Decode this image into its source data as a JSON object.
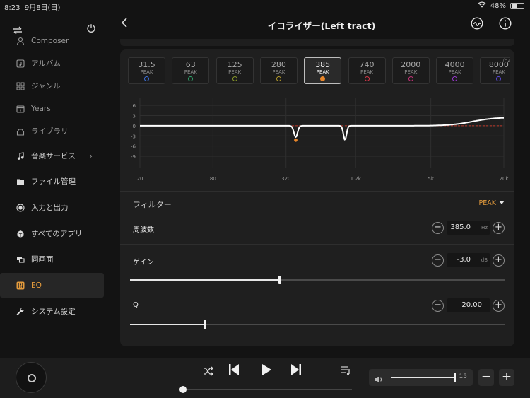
{
  "status": {
    "time": "8:23",
    "date": "9月8日(日)",
    "battery": "48%",
    "battery_level": 0.48
  },
  "sidebar": {
    "items": [
      {
        "label": "Composer",
        "icon": "person-icon",
        "dim": true
      },
      {
        "label": "アルバム",
        "icon": "album-icon",
        "dim": true
      },
      {
        "label": "ジャンル",
        "icon": "genre-grid-icon",
        "dim": true
      },
      {
        "label": "Years",
        "icon": "calendar-icon",
        "dim": true
      },
      {
        "label": "ライブラリ",
        "icon": "library-icon",
        "dim": true
      },
      {
        "label": "音楽サービス",
        "icon": "music-note-icon",
        "chevron": true
      },
      {
        "label": "ファイル管理",
        "icon": "folder-icon"
      },
      {
        "label": "入力と出力",
        "icon": "io-icon"
      },
      {
        "label": "すべてのアプリ",
        "icon": "apps-cube-icon"
      },
      {
        "label": "同画面",
        "icon": "screen-mirror-icon"
      },
      {
        "label": "EQ",
        "icon": "eq-icon",
        "active": true
      },
      {
        "label": "システム設定",
        "icon": "wrench-icon"
      }
    ]
  },
  "header": {
    "title": "イコライザー(Left tract)"
  },
  "bands": {
    "unit": "/Hz",
    "items": [
      {
        "freq": "31.5",
        "type": "PEAK",
        "color": "#3b6fd8"
      },
      {
        "freq": "63",
        "type": "PEAK",
        "color": "#2fa36b"
      },
      {
        "freq": "125",
        "type": "PEAK",
        "color": "#8a9a2a"
      },
      {
        "freq": "280",
        "type": "PEAK",
        "color": "#b49a2a"
      },
      {
        "freq": "385",
        "type": "PEAK",
        "color": "#e8862a",
        "selected": true
      },
      {
        "freq": "740",
        "type": "PEAK",
        "color": "#d8384a"
      },
      {
        "freq": "2000",
        "type": "PEAK",
        "color": "#c8327a"
      },
      {
        "freq": "4000",
        "type": "PEAK",
        "color": "#9a3ad0"
      },
      {
        "freq": "8000",
        "type": "PEAK",
        "color": "#5a48d8"
      }
    ]
  },
  "graph": {
    "y_ticks": [
      "6",
      "3",
      "0",
      "-3",
      "-6",
      "-9"
    ],
    "x_ticks": [
      "20",
      "80",
      "320",
      "1.2k",
      "5k",
      "20k"
    ],
    "curve_color": "#ffffff",
    "zero_line_color": "#c0392b",
    "marker_color": "#e8862a"
  },
  "filter": {
    "label": "フィルター",
    "type": "PEAK",
    "frequency": {
      "label": "周波数",
      "value": "385.0",
      "unit": "Hz"
    },
    "gain": {
      "label": "ゲイン",
      "value": "-3.0",
      "unit": "dB",
      "position": 0.4
    },
    "q": {
      "label": "Q",
      "value": "20.00",
      "position": 0.2
    }
  },
  "player": {
    "volume": "15",
    "volume_level": 0.99
  },
  "colors": {
    "accent": "#e29a3c",
    "background": "#131313",
    "panel": "#1f1f1f"
  }
}
